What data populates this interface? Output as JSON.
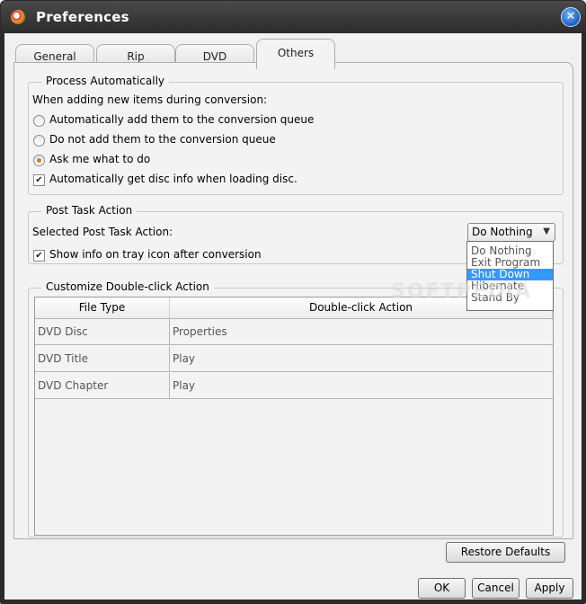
{
  "window": {
    "title": "Preferences",
    "close_glyph": "✕"
  },
  "tabs": [
    {
      "label": "General"
    },
    {
      "label": "Rip"
    },
    {
      "label": "DVD"
    },
    {
      "label": "Others",
      "active": true
    }
  ],
  "process_group": {
    "legend": "Process Automatically",
    "intro": "When adding new items during conversion:",
    "options": [
      {
        "label": "Automatically add them to the conversion queue",
        "checked": false
      },
      {
        "label": "Do not add them to the conversion queue",
        "checked": false
      },
      {
        "label": "Ask me what to do",
        "checked": true
      }
    ],
    "disc_info_label": "Automatically get disc info when loading disc.",
    "disc_info_checked": true
  },
  "post_task_group": {
    "legend": "Post Task Action",
    "select_label": "Selected Post Task Action:",
    "selected_value": "Do Nothing",
    "options": [
      "Do Nothing",
      "Exit Program",
      "Shut Down",
      "Hibernate",
      "Stand By"
    ],
    "highlighted_option": "Shut Down",
    "tray_label": "Show info on tray icon after conversion",
    "tray_checked": true
  },
  "double_click_group": {
    "legend": "Customize Double-click Action",
    "columns": [
      "File Type",
      "Double-click Action"
    ],
    "rows": [
      [
        "DVD Disc",
        "Properties"
      ],
      [
        "DVD Title",
        "Play"
      ],
      [
        "DVD Chapter",
        "Play"
      ]
    ]
  },
  "buttons": {
    "restore_defaults": "Restore Defaults",
    "ok": "OK",
    "cancel": "Cancel",
    "apply": "Apply"
  },
  "watermark": "SOFTPEDIA",
  "icons": {
    "app": "app-disc-icon",
    "close": "close-icon",
    "dropdown": "chevron-down-icon",
    "check": "checkmark-icon"
  }
}
